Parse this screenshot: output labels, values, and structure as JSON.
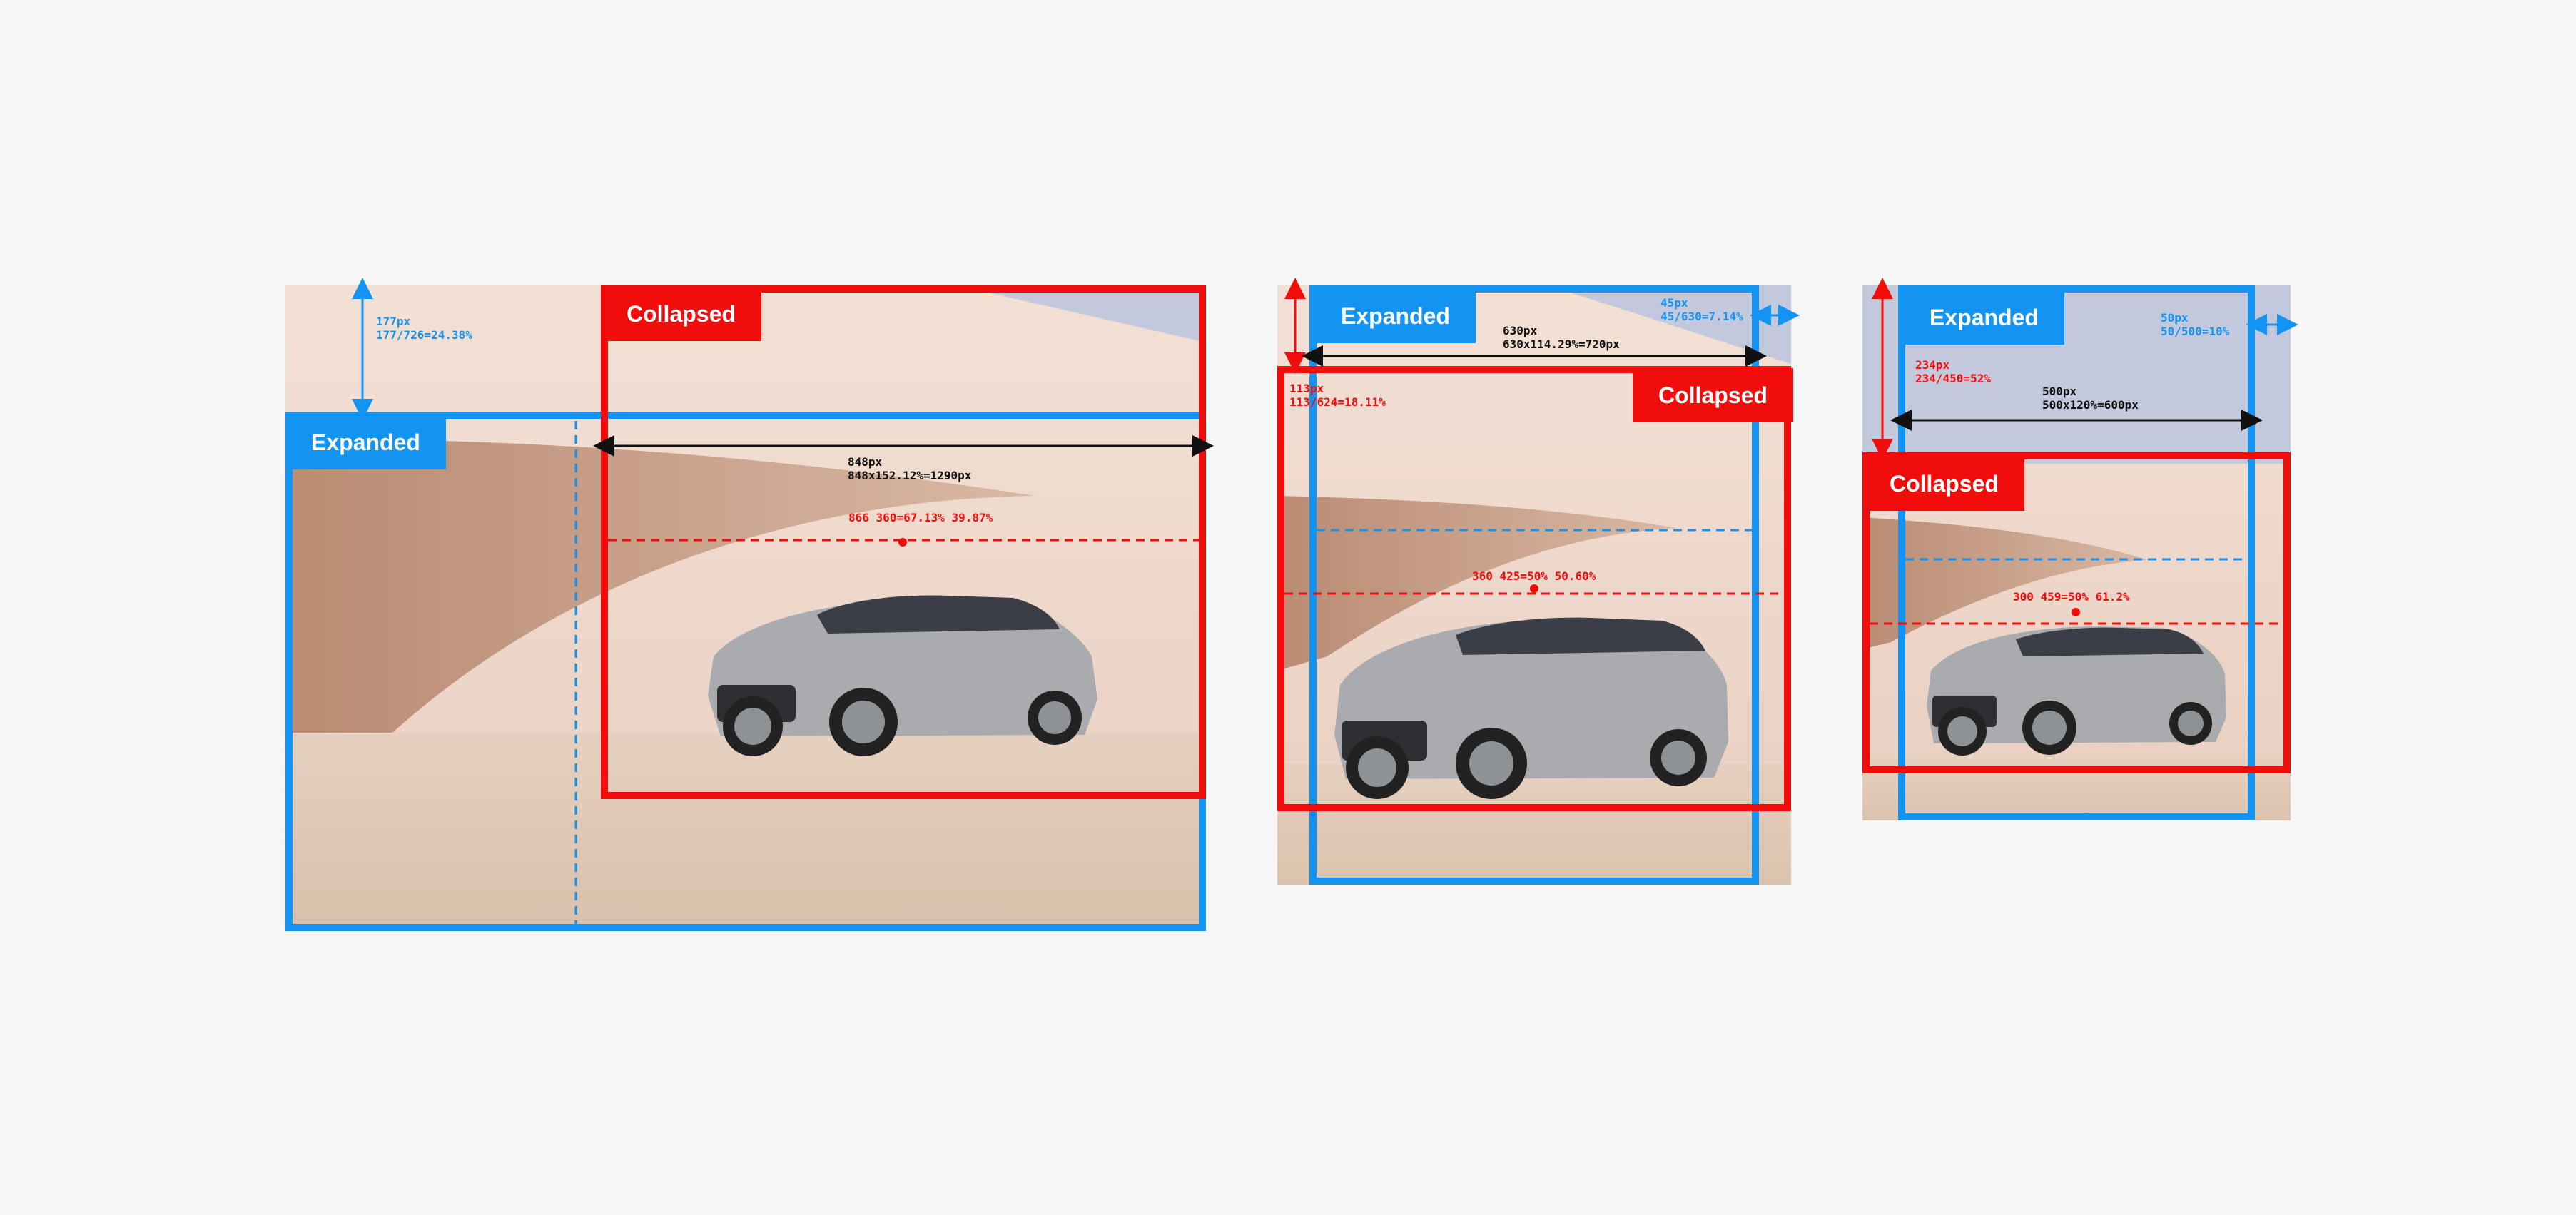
{
  "colors": {
    "expanded": "#1494f2",
    "collapsed": "#f20d0d",
    "background": "#f6f6f6"
  },
  "panels": [
    {
      "id": "desktop",
      "expanded_label": "Expanded",
      "collapsed_label": "Collapsed",
      "top_offset_annotation": [
        "177px",
        "177/726=24.38%"
      ],
      "width_annotation": [
        "848px",
        "848x152.12%=1290px"
      ],
      "focus_annotation": "866 360=67.13% 39.87%"
    },
    {
      "id": "tablet",
      "expanded_label": "Expanded",
      "collapsed_label": "Collapsed",
      "side_offset_annotation": [
        "45px",
        "45/630=7.14%"
      ],
      "width_annotation": [
        "630px",
        "630x114.29%=720px"
      ],
      "top_offset_annotation": [
        "113px",
        "113/624=18.11%"
      ],
      "focus_annotation": "360 425=50% 50.60%"
    },
    {
      "id": "mobile",
      "expanded_label": "Expanded",
      "collapsed_label": "Collapsed",
      "side_offset_annotation": [
        "50px",
        "50/500=10%"
      ],
      "top_offset_annotation": [
        "234px",
        "234/450=52%"
      ],
      "width_annotation": [
        "500px",
        "500x120%=600px"
      ],
      "focus_annotation": "300 459=50% 61.2%"
    }
  ]
}
